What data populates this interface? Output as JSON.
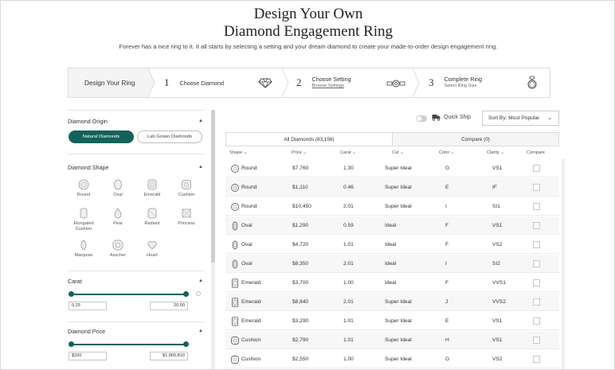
{
  "header": {
    "title_line1": "Design Your Own",
    "title_line2": "Diamond Engagement Ring",
    "subtitle": "Forever has a nice ring to it. It all starts by selecting a setting and your dream diamond to create your made-to-order design engagement ring."
  },
  "steps": {
    "intro": "Design Your Ring",
    "items": [
      {
        "num": "1",
        "label": "Choose Diamond",
        "sub": "",
        "icon": "diamond-icon"
      },
      {
        "num": "2",
        "label": "Choose Setting",
        "sub": "Browse Settings",
        "icon": "setting-icon"
      },
      {
        "num": "3",
        "label": "Complete Ring",
        "sub": "Select Ring Size",
        "icon": "ring-icon"
      }
    ]
  },
  "filters": {
    "origin": {
      "title": "Diamond Origin",
      "options": [
        "Natural Diamonds",
        "Lab Grown Diamonds"
      ],
      "selected": "Natural Diamonds"
    },
    "shape": {
      "title": "Diamond Shape",
      "items": [
        "Round",
        "Oval",
        "Emerald",
        "Cushion",
        "Elongated Cushion",
        "Pear",
        "Radiant",
        "Princess",
        "Marquise",
        "Asscher",
        "Heart"
      ]
    },
    "carat": {
      "title": "Carat",
      "min": "0.25",
      "max": "20.00"
    },
    "price": {
      "title": "Diamond Price",
      "min": "$320",
      "max": "$1,965,810"
    }
  },
  "toolbar": {
    "quick_ship": "Quick Ship",
    "sort": "Sort By: Most Popular"
  },
  "tabs": {
    "all": "All Diamonds (83,156)",
    "compare": "Compare (0)"
  },
  "table": {
    "columns": [
      "Shape",
      "Price",
      "Carat",
      "Cut",
      "Color",
      "Clarity",
      "Compare"
    ],
    "rows": [
      {
        "shape": "Round",
        "price": "$7,760",
        "carat": "1.30",
        "cut": "Super Ideal",
        "color": "G",
        "clarity": "VS1"
      },
      {
        "shape": "Round",
        "price": "$1,110",
        "carat": "0.46",
        "cut": "Super Ideal",
        "color": "E",
        "clarity": "IF"
      },
      {
        "shape": "Round",
        "price": "$10,450",
        "carat": "2.01",
        "cut": "Super Ideal",
        "color": "I",
        "clarity": "SI1"
      },
      {
        "shape": "Oval",
        "price": "$1,290",
        "carat": "0.59",
        "cut": "Ideal",
        "color": "F",
        "clarity": "VS1"
      },
      {
        "shape": "Oval",
        "price": "$4,720",
        "carat": "1.01",
        "cut": "Ideal",
        "color": "F",
        "clarity": "VS2"
      },
      {
        "shape": "Oval",
        "price": "$8,350",
        "carat": "2.01",
        "cut": "Ideal",
        "color": "I",
        "clarity": "SI2"
      },
      {
        "shape": "Emerald",
        "price": "$3,700",
        "carat": "1.00",
        "cut": "Ideal",
        "color": "F",
        "clarity": "VVS1"
      },
      {
        "shape": "Emerald",
        "price": "$8,840",
        "carat": "2.01",
        "cut": "Super Ideal",
        "color": "J",
        "clarity": "VVS2"
      },
      {
        "shape": "Emerald",
        "price": "$3,290",
        "carat": "1.01",
        "cut": "Super Ideal",
        "color": "E",
        "clarity": "VS1"
      },
      {
        "shape": "Cushion",
        "price": "$2,790",
        "carat": "1.01",
        "cut": "Super Ideal",
        "color": "H",
        "clarity": "VS1"
      },
      {
        "shape": "Cushion",
        "price": "$2,550",
        "carat": "1.00",
        "cut": "Super Ideal",
        "color": "G",
        "clarity": "VS2"
      }
    ]
  },
  "colors": {
    "accent": "#15615b",
    "border": "#dcdcdc",
    "text": "#222222"
  }
}
